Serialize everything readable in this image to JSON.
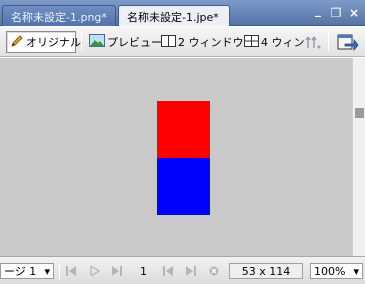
{
  "tabs": [
    {
      "label": "名称未設定-1.png*"
    },
    {
      "label": "名称未設定-1.jpe*"
    }
  ],
  "window_controls": {
    "minimize": "_",
    "maximize": "❐",
    "close": "×"
  },
  "toolbar": {
    "original_label": "オリジナル",
    "preview_label": "プレビュー",
    "two_window_label": "2 ウィンドウ",
    "four_window_label": "4 ウィン",
    "icons": {
      "original": "pencil-icon",
      "preview": "picture-icon",
      "two_window": "two-pane-icon",
      "four_window": "four-pane-icon",
      "export_options": "dimmed-sliders-icon",
      "export": "export-arrow-icon"
    }
  },
  "canvas": {
    "background": "#c9c9c9",
    "shapes": [
      {
        "name": "red-rectangle",
        "color": "#ff0000"
      },
      {
        "name": "blue-rectangle",
        "color": "#0000ff"
      }
    ]
  },
  "statusbar": {
    "page_label": "ージ 1",
    "frame_number": "1",
    "dimensions": "53 x 114",
    "zoom": "100%"
  }
}
